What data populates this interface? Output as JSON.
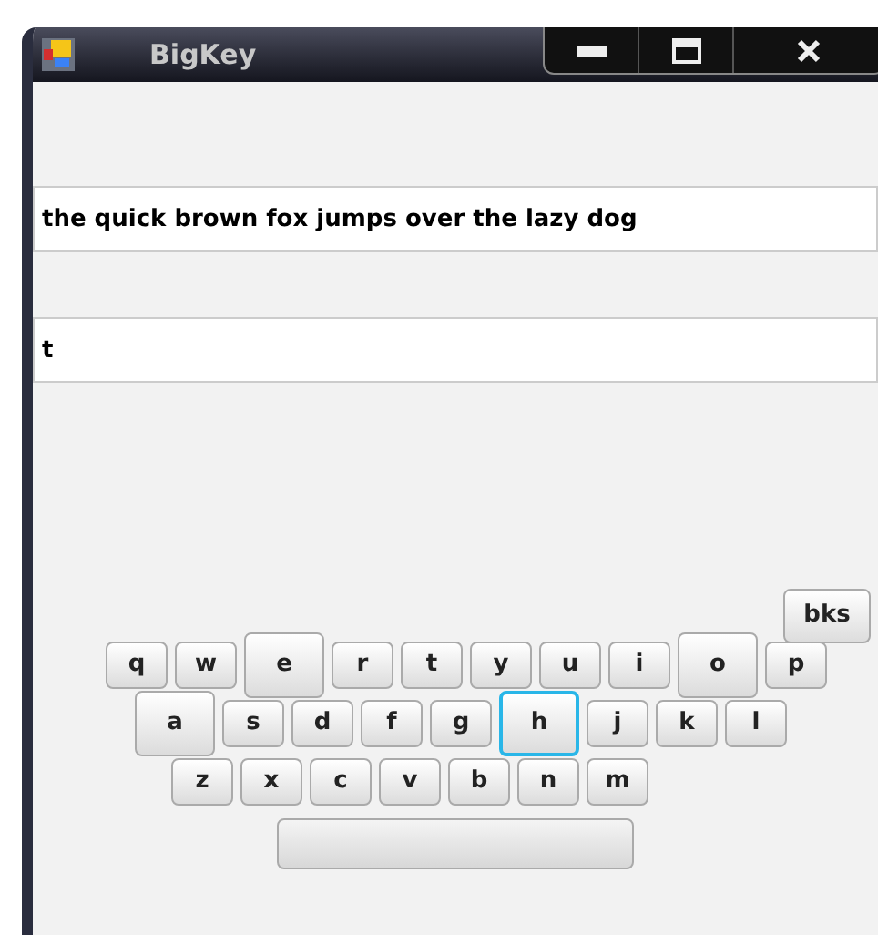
{
  "window": {
    "title": "BigKey"
  },
  "phrase_field": {
    "value": "the quick brown fox jumps over the lazy dog"
  },
  "typed_field": {
    "value": "t"
  },
  "keyboard": {
    "backspace": "bks",
    "rows": [
      [
        {
          "label": "q",
          "enlarged": false,
          "selected": false
        },
        {
          "label": "w",
          "enlarged": false,
          "selected": false
        },
        {
          "label": "e",
          "enlarged": true,
          "selected": false
        },
        {
          "label": "r",
          "enlarged": false,
          "selected": false
        },
        {
          "label": "t",
          "enlarged": false,
          "selected": false
        },
        {
          "label": "y",
          "enlarged": false,
          "selected": false
        },
        {
          "label": "u",
          "enlarged": false,
          "selected": false
        },
        {
          "label": "i",
          "enlarged": false,
          "selected": false
        },
        {
          "label": "o",
          "enlarged": true,
          "selected": false
        },
        {
          "label": "p",
          "enlarged": false,
          "selected": false
        }
      ],
      [
        {
          "label": "a",
          "enlarged": true,
          "selected": false
        },
        {
          "label": "s",
          "enlarged": false,
          "selected": false
        },
        {
          "label": "d",
          "enlarged": false,
          "selected": false
        },
        {
          "label": "f",
          "enlarged": false,
          "selected": false
        },
        {
          "label": "g",
          "enlarged": false,
          "selected": false
        },
        {
          "label": "h",
          "enlarged": true,
          "selected": true
        },
        {
          "label": "j",
          "enlarged": false,
          "selected": false
        },
        {
          "label": "k",
          "enlarged": false,
          "selected": false
        },
        {
          "label": "l",
          "enlarged": false,
          "selected": false
        }
      ],
      [
        {
          "label": "z",
          "enlarged": false,
          "selected": false
        },
        {
          "label": "x",
          "enlarged": false,
          "selected": false
        },
        {
          "label": "c",
          "enlarged": false,
          "selected": false
        },
        {
          "label": "v",
          "enlarged": false,
          "selected": false
        },
        {
          "label": "b",
          "enlarged": false,
          "selected": false
        },
        {
          "label": "n",
          "enlarged": false,
          "selected": false
        },
        {
          "label": "m",
          "enlarged": false,
          "selected": false
        }
      ]
    ]
  }
}
